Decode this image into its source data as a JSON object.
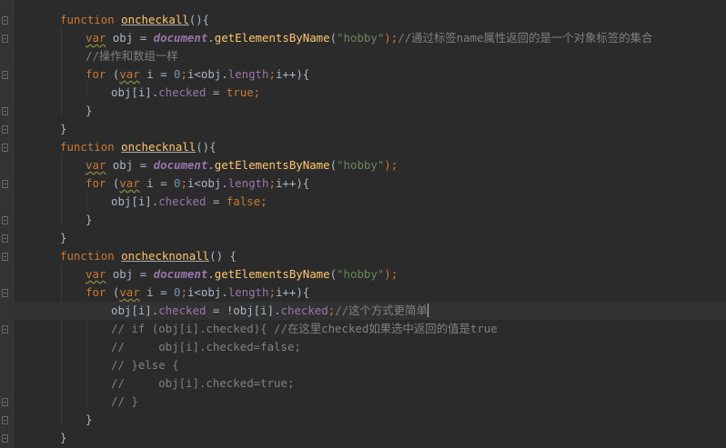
{
  "editor": {
    "lines": [
      {
        "tokens": [
          {
            "t": "function ",
            "c": "kw"
          },
          {
            "t": "oncheckall",
            "c": "fn"
          },
          {
            "t": "(){",
            "c": "p"
          }
        ]
      },
      {
        "tokens": [
          {
            "t": "var",
            "c": "kw squig"
          },
          {
            "t": " obj = ",
            "c": "p"
          },
          {
            "t": "document",
            "c": "glob"
          },
          {
            "t": ".",
            "c": "p"
          },
          {
            "t": "getElementsByName",
            "c": "meth"
          },
          {
            "t": "(",
            "c": "p"
          },
          {
            "t": "\"hobby\"",
            "c": "str"
          },
          {
            "t": ");",
            "c": "kw"
          },
          {
            "t": "//通过标签name属性返回的是一个对象标签的集合",
            "c": "cm"
          }
        ]
      },
      {
        "tokens": [
          {
            "t": "//操作和数组一样",
            "c": "cm"
          }
        ]
      },
      {
        "tokens": [
          {
            "t": "for",
            "c": "kw"
          },
          {
            "t": " (",
            "c": "p"
          },
          {
            "t": "var",
            "c": "kw squig"
          },
          {
            "t": " i = ",
            "c": "p"
          },
          {
            "t": "0",
            "c": "num"
          },
          {
            "t": ";",
            "c": "kw"
          },
          {
            "t": "i<obj.",
            "c": "p"
          },
          {
            "t": "length",
            "c": "prop"
          },
          {
            "t": ";",
            "c": "kw"
          },
          {
            "t": "i++){",
            "c": "p"
          }
        ]
      },
      {
        "tokens": [
          {
            "t": "obj[i].",
            "c": "p"
          },
          {
            "t": "checked",
            "c": "prop"
          },
          {
            "t": " = ",
            "c": "p"
          },
          {
            "t": "true",
            "c": "kw"
          },
          {
            "t": ";",
            "c": "kw"
          }
        ]
      },
      {
        "tokens": [
          {
            "t": "}",
            "c": "p"
          }
        ]
      },
      {
        "tokens": [
          {
            "t": "}",
            "c": "p"
          }
        ]
      },
      {
        "tokens": [
          {
            "t": "function ",
            "c": "kw"
          },
          {
            "t": "onchecknall",
            "c": "fn"
          },
          {
            "t": "(){",
            "c": "p"
          }
        ]
      },
      {
        "tokens": [
          {
            "t": "var",
            "c": "kw squig"
          },
          {
            "t": " obj = ",
            "c": "p"
          },
          {
            "t": "document",
            "c": "glob"
          },
          {
            "t": ".",
            "c": "p"
          },
          {
            "t": "getElementsByName",
            "c": "meth"
          },
          {
            "t": "(",
            "c": "p"
          },
          {
            "t": "\"hobby\"",
            "c": "str"
          },
          {
            "t": ");",
            "c": "kw"
          }
        ]
      },
      {
        "tokens": [
          {
            "t": "for",
            "c": "kw"
          },
          {
            "t": " (",
            "c": "p"
          },
          {
            "t": "var",
            "c": "kw squig"
          },
          {
            "t": " i = ",
            "c": "p"
          },
          {
            "t": "0",
            "c": "num"
          },
          {
            "t": ";",
            "c": "kw"
          },
          {
            "t": "i<obj.",
            "c": "p"
          },
          {
            "t": "length",
            "c": "prop"
          },
          {
            "t": ";",
            "c": "kw"
          },
          {
            "t": "i++){",
            "c": "p"
          }
        ]
      },
      {
        "tokens": [
          {
            "t": "obj[i].",
            "c": "p"
          },
          {
            "t": "checked",
            "c": "prop"
          },
          {
            "t": " = ",
            "c": "p"
          },
          {
            "t": "false",
            "c": "kw"
          },
          {
            "t": ";",
            "c": "kw"
          }
        ]
      },
      {
        "tokens": [
          {
            "t": "}",
            "c": "p"
          }
        ]
      },
      {
        "tokens": [
          {
            "t": "}",
            "c": "p"
          }
        ]
      },
      {
        "tokens": [
          {
            "t": "function ",
            "c": "kw"
          },
          {
            "t": "onchecknonall",
            "c": "fn"
          },
          {
            "t": "() {",
            "c": "p"
          }
        ]
      },
      {
        "tokens": [
          {
            "t": "var",
            "c": "kw squig"
          },
          {
            "t": " obj = ",
            "c": "p"
          },
          {
            "t": "document",
            "c": "glob"
          },
          {
            "t": ".",
            "c": "p"
          },
          {
            "t": "getElementsByName",
            "c": "meth"
          },
          {
            "t": "(",
            "c": "p"
          },
          {
            "t": "\"hobby\"",
            "c": "str"
          },
          {
            "t": ");",
            "c": "kw"
          }
        ]
      },
      {
        "tokens": [
          {
            "t": "for",
            "c": "kw"
          },
          {
            "t": " (",
            "c": "p"
          },
          {
            "t": "var",
            "c": "kw squig"
          },
          {
            "t": " i = ",
            "c": "p"
          },
          {
            "t": "0",
            "c": "num"
          },
          {
            "t": ";",
            "c": "kw"
          },
          {
            "t": "i<obj.",
            "c": "p"
          },
          {
            "t": "length",
            "c": "prop"
          },
          {
            "t": ";",
            "c": "kw"
          },
          {
            "t": "i++){",
            "c": "p"
          }
        ]
      },
      {
        "tokens": [
          {
            "t": "obj[i].",
            "c": "p"
          },
          {
            "t": "checked",
            "c": "prop"
          },
          {
            "t": " = !obj[i].",
            "c": "p"
          },
          {
            "t": "checked",
            "c": "prop"
          },
          {
            "t": ";",
            "c": "kw"
          },
          {
            "t": "//这个方式更简单",
            "c": "cm"
          }
        ]
      },
      {
        "tokens": [
          {
            "t": "// if (obj[i].checked){ //在这里checked如果选中返回的值是true",
            "c": "cm"
          }
        ]
      },
      {
        "tokens": [
          {
            "t": "//     obj[i].checked=false;",
            "c": "cm"
          }
        ]
      },
      {
        "tokens": [
          {
            "t": "// }else {",
            "c": "cm"
          }
        ]
      },
      {
        "tokens": [
          {
            "t": "//     obj[i].checked=true;",
            "c": "cm"
          }
        ]
      },
      {
        "tokens": [
          {
            "t": "// }",
            "c": "cm"
          }
        ]
      },
      {
        "tokens": [
          {
            "t": "}",
            "c": "p"
          }
        ]
      },
      {
        "tokens": [
          {
            "t": "}",
            "c": "p"
          }
        ]
      }
    ]
  }
}
